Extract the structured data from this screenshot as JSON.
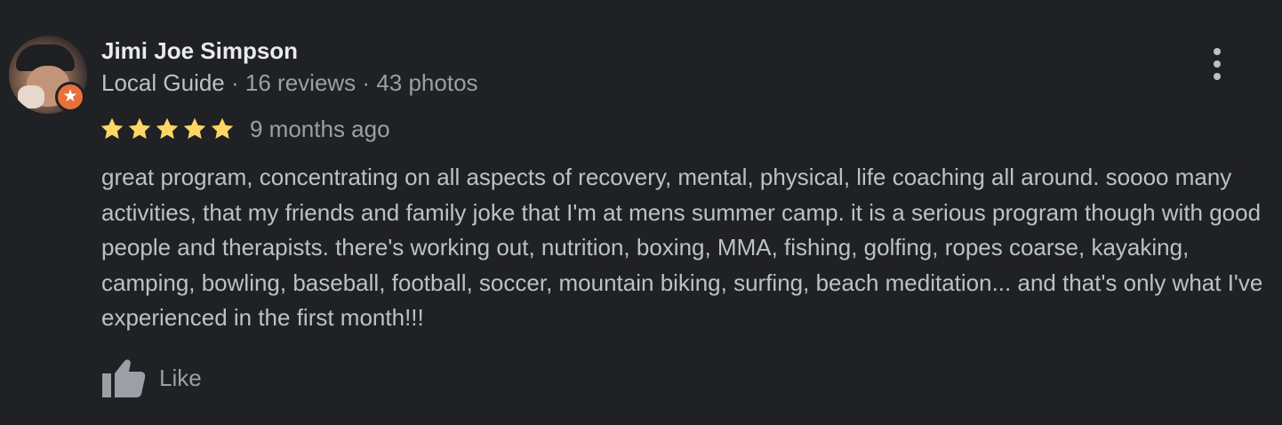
{
  "review": {
    "author": {
      "name": "Jimi Joe Simpson",
      "badge": "Local Guide",
      "reviews_count": "16 reviews",
      "photos_count": "43 photos",
      "separator": "·"
    },
    "rating": {
      "stars": 5,
      "max": 5,
      "star_color": "#fdd663"
    },
    "date": "9 months ago",
    "text": "great program, concentrating on all aspects of recovery, mental, physical, life coaching all around. soooo many activities, that my friends and family joke that I'm at mens summer camp. it is a serious program though with good people and therapists. there's working out, nutrition, boxing, MMA, fishing, golfing, ropes coarse, kayaking, camping, bowling, baseball, football, soccer, mountain biking, surfing, beach meditation... and that's only what I've experienced in the first month!!!",
    "like_label": "Like"
  },
  "theme": {
    "background": "#202124",
    "local_guide_badge_color": "#e8703b"
  },
  "icons": {
    "more": "more-vert-icon",
    "like": "thumb-up-icon",
    "badge": "star-icon"
  }
}
